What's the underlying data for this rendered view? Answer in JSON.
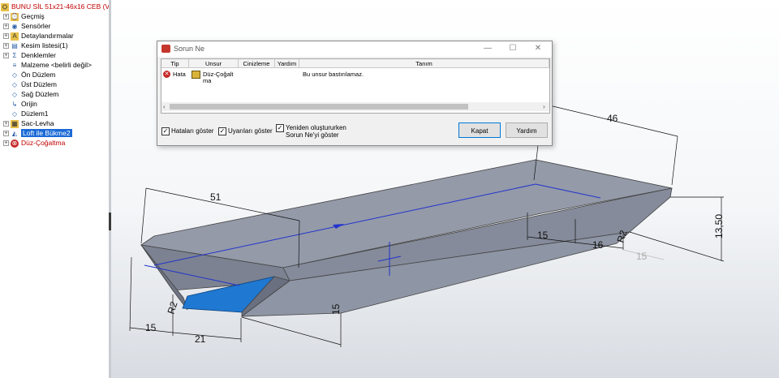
{
  "feature_tree": {
    "items": [
      {
        "label": "BUNU SİL 51x21-46x16 CEB  (Va",
        "icon": "part-icon",
        "style": "red"
      },
      {
        "label": "Geçmiş",
        "icon": "history-icon",
        "style": ""
      },
      {
        "label": "Sensörler",
        "icon": "sensor-icon",
        "style": ""
      },
      {
        "label": "Detaylandırmalar",
        "icon": "annotation-icon",
        "style": ""
      },
      {
        "label": "Kesim listesi(1)",
        "icon": "cut-list-icon",
        "style": ""
      },
      {
        "label": "Denklemler",
        "icon": "equation-icon",
        "style": ""
      },
      {
        "label": "Malzeme <belirli değil>",
        "icon": "material-icon",
        "style": ""
      },
      {
        "label": "Ön Düzlem",
        "icon": "plane-icon",
        "style": ""
      },
      {
        "label": "Üst Düzlem",
        "icon": "plane-icon",
        "style": ""
      },
      {
        "label": "Sağ Düzlem",
        "icon": "plane-icon",
        "style": ""
      },
      {
        "label": "Orijin",
        "icon": "origin-icon",
        "style": ""
      },
      {
        "label": "Düzlem1",
        "icon": "plane-icon",
        "style": ""
      },
      {
        "label": "Sac-Levha",
        "icon": "sheet-metal-icon",
        "style": ""
      },
      {
        "label": "Loft ile Bükme2",
        "icon": "lofted-bend-icon",
        "style": "selected"
      },
      {
        "label": "Düz-Çoğaltma",
        "icon": "error-icon",
        "style": "red"
      }
    ]
  },
  "dialog": {
    "title": "Sorun Ne",
    "columns": [
      "Tip",
      "Unsur",
      "Cinizleme",
      "Yardım",
      "Tanım"
    ],
    "rows": [
      {
        "type": "Hata",
        "feature": "Düz-Çoğalt ma",
        "preview": "",
        "help": "",
        "description": "Bu unsur bastırılamaz."
      }
    ],
    "checkboxes": [
      {
        "label": "Hataları göster",
        "checked": true
      },
      {
        "label": "Uyarıları göster",
        "checked": true
      },
      {
        "label": "Yeniden oluştururken Sorun Ne'yi göster",
        "checked": true
      }
    ],
    "buttons": {
      "close": "Kapat",
      "help": "Yardım"
    },
    "window_controls": {
      "minimize": "—",
      "maximize": "☐",
      "close": "✕"
    }
  },
  "dimensions": {
    "d51": "51",
    "d15_left": "15",
    "d21": "21",
    "d15_mid": "15",
    "r2_left": "R2",
    "d46": "46",
    "d15_right": "15",
    "d16": "16",
    "r2_right": "R2",
    "d13_50": "13,50",
    "d15_ghost": "15"
  },
  "colors": {
    "accent": "#1a6ad6",
    "part_face": "#8e95a4",
    "highlight_face": "#1f78d1",
    "error_red": "#c00000"
  }
}
